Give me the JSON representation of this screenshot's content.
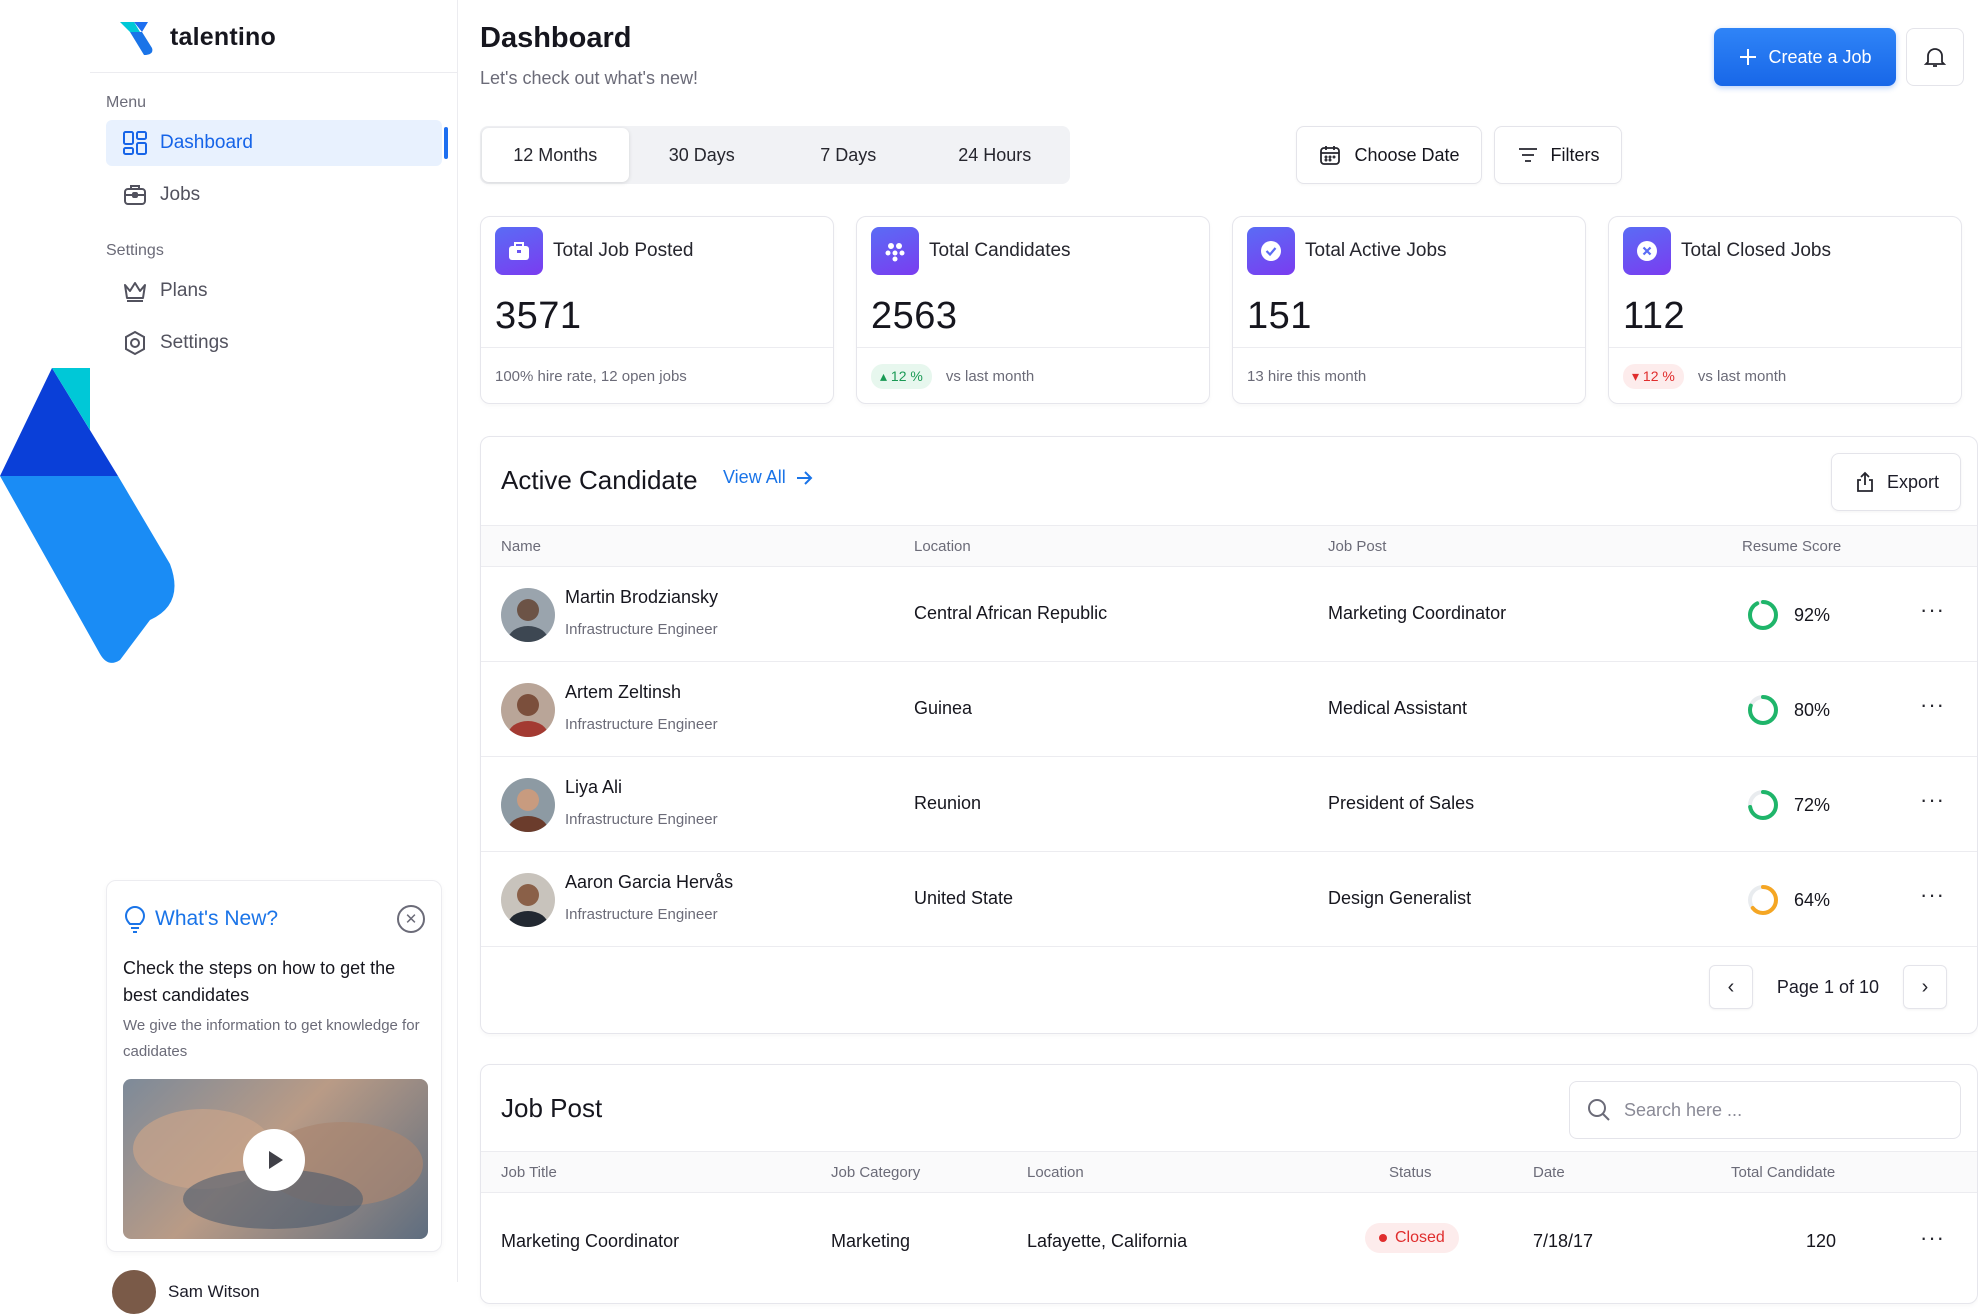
{
  "brand": {
    "name": "talentino",
    "colors": {
      "primary": "#1e6ff0",
      "accent": "#00c8d7"
    }
  },
  "sidebar": {
    "menu_label": "Menu",
    "settings_label": "Settings",
    "items": [
      {
        "label": "Dashboard",
        "icon": "grid-icon",
        "active": true
      },
      {
        "label": "Jobs",
        "icon": "briefcase-icon"
      },
      {
        "label": "Plans",
        "icon": "crown-icon"
      },
      {
        "label": "Settings",
        "icon": "gear-icon"
      }
    ],
    "whats_new": {
      "heading": "What's New?",
      "title": "Check the steps on how to get the best candidates",
      "description": "We give the information to get knowledge for cadidates"
    },
    "user_name": "Sam Witson"
  },
  "header": {
    "title": "Dashboard",
    "subtitle": "Let's check out what's new!",
    "create_label": "Create a Job"
  },
  "filters": {
    "ranges": [
      "12 Months",
      "30 Days",
      "7 Days",
      "24 Hours"
    ],
    "active_range": "12 Months",
    "choose_date_label": "Choose Date",
    "filters_label": "Filters"
  },
  "stats": [
    {
      "label": "Total Job Posted",
      "value": "3571",
      "foot": "100% hire rate,  12 open jobs",
      "icon": "briefcase-icon"
    },
    {
      "label": "Total Candidates",
      "value": "2563",
      "change": "12 %",
      "direction": "up",
      "foot": "vs last month",
      "icon": "people-icon"
    },
    {
      "label": "Total Active Jobs",
      "value": "151",
      "foot": "13 hire this month",
      "icon": "check-circle-icon"
    },
    {
      "label": "Total Closed Jobs",
      "value": "112",
      "change": "12 %",
      "direction": "down",
      "foot": "vs last month",
      "icon": "x-circle-icon"
    }
  ],
  "active_candidates": {
    "title": "Active Candidate",
    "view_all_label": "View All",
    "export_label": "Export",
    "columns": [
      "Name",
      "Location",
      "Job Post",
      "Resume Score"
    ],
    "rows": [
      {
        "name": "Martin Brodziansky",
        "role": "Infrastructure Engineer",
        "location": "Central African Republic",
        "job_post": "Marketing Coordinator",
        "score": "92%",
        "score_value": 0.92,
        "score_color": "#1fb56a"
      },
      {
        "name": "Artem Zeltinsh",
        "role": "Infrastructure Engineer",
        "location": "Guinea",
        "job_post": "Medical Assistant",
        "score": "80%",
        "score_value": 0.8,
        "score_color": "#1fb56a"
      },
      {
        "name": "Liya Ali",
        "role": "Infrastructure Engineer",
        "location": "Reunion",
        "job_post": "President of Sales",
        "score": "72%",
        "score_value": 0.72,
        "score_color": "#1fb56a"
      },
      {
        "name": "Aaron Garcia Hervås",
        "role": "Infrastructure Engineer",
        "location": "United State",
        "job_post": "Design Generalist",
        "score": "64%",
        "score_value": 0.64,
        "score_color": "#f5a623"
      }
    ],
    "page_label": "Page 1 of 10"
  },
  "job_post": {
    "title": "Job Post",
    "search_placeholder": "Search here ...",
    "columns": [
      "Job Title",
      "Job Category",
      "Location",
      "Status",
      "Date",
      "Total Candidate"
    ],
    "rows": [
      {
        "title": "Marketing Coordinator",
        "category": "Marketing",
        "location": "Lafayette, California",
        "status": "Closed",
        "date": "7/18/17",
        "total": "120"
      }
    ]
  }
}
